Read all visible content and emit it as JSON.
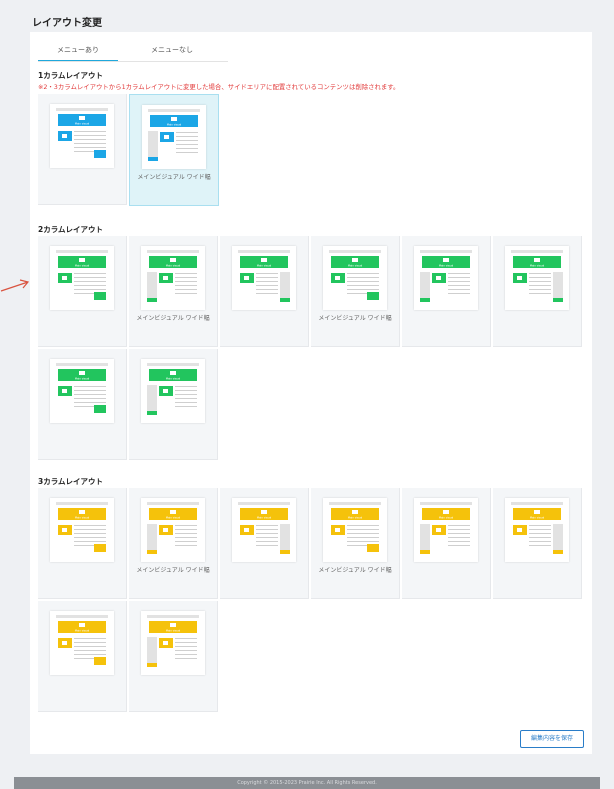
{
  "page": {
    "title": "レイアウト変更"
  },
  "tabs": [
    {
      "label": "メニューあり",
      "active": true
    },
    {
      "label": "メニューなし",
      "active": false
    }
  ],
  "sections": {
    "one_col": {
      "title": "1カラムレイアウト",
      "warning": "※2・3カラムレイアウトから1カラムレイアウトに変更した場合、サイドエリアに配置されているコンテンツは削除されます。",
      "color": "#1ba6e6",
      "cards": [
        {
          "label": "",
          "selected": false
        },
        {
          "label": "メインビジュアル ワイド幅",
          "selected": true
        }
      ]
    },
    "two_col": {
      "title": "2カラムレイアウト",
      "color": "#22c55e",
      "cards": [
        {
          "label": ""
        },
        {
          "label": "メインビジュアル ワイド幅"
        },
        {
          "label": ""
        },
        {
          "label": "メインビジュアル ワイド幅"
        },
        {
          "label": ""
        },
        {
          "label": ""
        },
        {
          "label": ""
        },
        {
          "label": ""
        }
      ]
    },
    "three_col": {
      "title": "3カラムレイアウト",
      "color": "#f5c20b",
      "cards": [
        {
          "label": ""
        },
        {
          "label": "メインビジュアル ワイド幅"
        },
        {
          "label": ""
        },
        {
          "label": "メインビジュアル ワイド幅"
        },
        {
          "label": ""
        },
        {
          "label": ""
        },
        {
          "label": ""
        },
        {
          "label": ""
        }
      ]
    }
  },
  "buttons": {
    "save": "編集内容を保存"
  },
  "footer": {
    "copyright": "Copyright © 2015-2023 Prairie Inc. All Rights Reserved."
  },
  "banner_text": "Main visual"
}
